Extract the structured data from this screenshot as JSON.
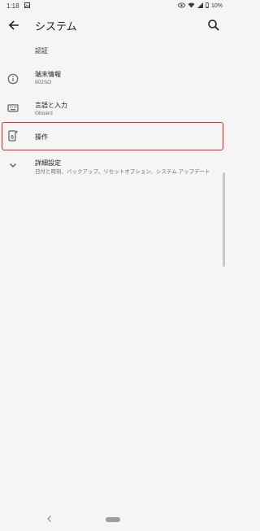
{
  "status_bar": {
    "time": "1:18",
    "battery": "10%"
  },
  "app_bar": {
    "title": "システム"
  },
  "section": {
    "label": "認証"
  },
  "items": [
    {
      "icon": "info-icon",
      "primary": "端末情報",
      "secondary": "902SO"
    },
    {
      "icon": "keyboard-icon",
      "primary": "言語と入力",
      "secondary": "Gboard"
    },
    {
      "icon": "gesture-icon",
      "primary": "操作",
      "secondary": ""
    },
    {
      "icon": "chevron-down-icon",
      "primary": "詳細設定",
      "secondary": "日付と時刻、バックアップ、リセットオプション、システム アップデート"
    }
  ],
  "colors": {
    "highlight": "#e2262b",
    "background": "#f5f5f5"
  }
}
